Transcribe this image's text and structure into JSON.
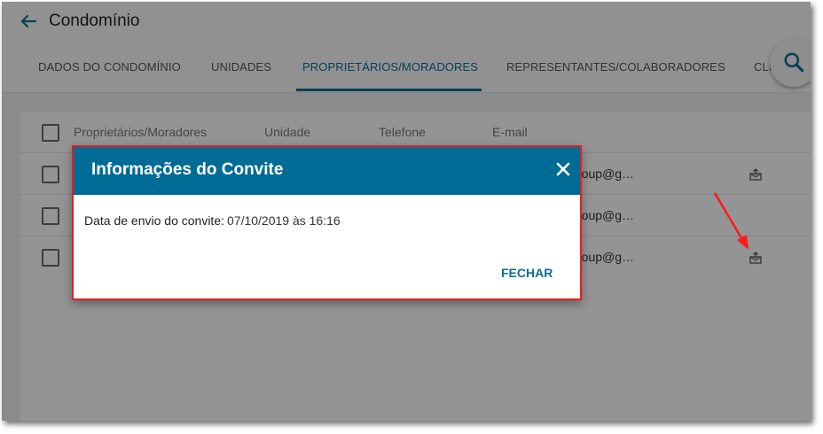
{
  "app": {
    "title": "Condomínio"
  },
  "tabs": [
    {
      "label": "DADOS DO CONDOMÍNIO",
      "active": false
    },
    {
      "label": "UNIDADES",
      "active": false
    },
    {
      "label": "PROPRIETÁRIOS/MORADORES",
      "active": true
    },
    {
      "label": "REPRESENTANTES/COLABORADORES",
      "active": false
    },
    {
      "label": "CLI",
      "active": false
    }
  ],
  "table": {
    "headers": [
      "Proprietários/Moradores",
      "Unidade",
      "Telefone",
      "E-mail"
    ],
    "rows": [
      {
        "email": "roup@g…",
        "invite_icon": "mailbox-invite-icon"
      },
      {
        "email": "roup@g…",
        "invite_icon": null
      },
      {
        "email": "roup@g…",
        "invite_icon": "mailbox-invite-icon"
      }
    ]
  },
  "dialog": {
    "title": "Informações do Convite",
    "label": "Data de envio do convite:",
    "value": "07/10/2019 às 16:16",
    "button": "FECHAR"
  },
  "colors": {
    "accent": "#006b94",
    "highlight": "#e02020"
  },
  "icons": [
    "back-arrow-icon",
    "search-icon",
    "close-icon",
    "mailbox-invite-icon",
    "checkbox-icon"
  ]
}
